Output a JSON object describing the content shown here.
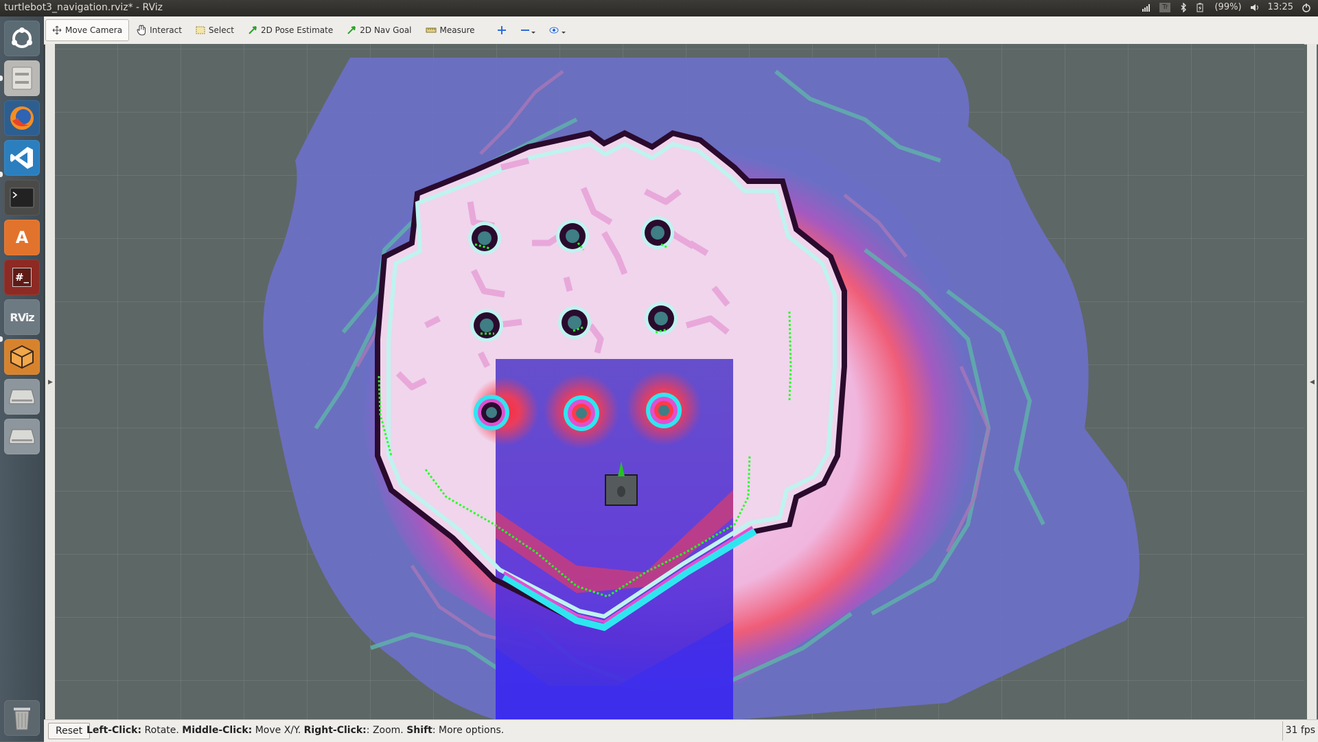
{
  "window": {
    "title": "turtlebot3_navigation.rviz* - RViz"
  },
  "tray": {
    "keyboard": "Tr",
    "battery": "(99%)",
    "clock": "13:25"
  },
  "launcher": {
    "items": [
      {
        "name": "ubuntu-dash-icon",
        "glyph": "◉"
      },
      {
        "name": "files-icon",
        "glyph": ""
      },
      {
        "name": "firefox-icon",
        "glyph": ""
      },
      {
        "name": "vscode-icon",
        "glyph": ""
      },
      {
        "name": "terminal-icon",
        "glyph": ">_"
      },
      {
        "name": "software-center-icon",
        "glyph": "A"
      },
      {
        "name": "remote-terminal-icon",
        "glyph": "#_"
      },
      {
        "name": "rviz-icon",
        "glyph": "RViz"
      },
      {
        "name": "gazebo-icon",
        "glyph": ""
      },
      {
        "name": "drive-icon",
        "glyph": ""
      },
      {
        "name": "drive-icon",
        "glyph": ""
      },
      {
        "name": "trash-icon",
        "glyph": ""
      }
    ]
  },
  "toolbar": {
    "move_camera": "Move Camera",
    "interact": "Interact",
    "select": "Select",
    "pose_estimate": "2D Pose Estimate",
    "nav_goal": "2D Nav Goal",
    "measure": "Measure"
  },
  "status": {
    "reset": "Reset",
    "hint_left_click": "Left-Click:",
    "hint_rotate": " Rotate. ",
    "hint_middle_click": "Middle-Click:",
    "hint_move": " Move X/Y. ",
    "hint_right_click": "Right-Click:",
    "hint_zoom": ": Zoom. ",
    "hint_shift": "Shift",
    "hint_more": ": More options.",
    "fps": "31 fps"
  },
  "colors": {
    "grid_background": "#5d6766",
    "global_costmap_outer": "#6a6fc6",
    "inflation_red": "#ff3b4a",
    "free_space": "#f3d9ef",
    "obstacle": "#2a0b2e",
    "local_costmap": "#5a32d8",
    "laser_scan": "#25ff25"
  }
}
